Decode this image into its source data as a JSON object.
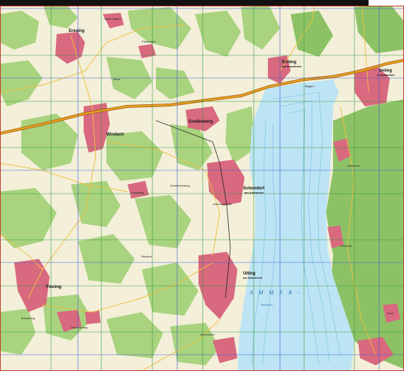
{
  "map": {
    "colors": {
      "background": "#f3efd9",
      "forest": "#a9d37f",
      "forest_dark": "#8cc265",
      "settlement": "#d9697f",
      "settlement_light": "#e9a7b4",
      "water": "#bde4f4",
      "water_contour": "#6fbde4",
      "motorway": "#e8a020",
      "motorway_edge": "#a05a10",
      "road": "#f0c040",
      "grid_green": "#2e9a3a",
      "grid_blue": "#3a5ad8",
      "border": "#c0392b"
    },
    "lake": {
      "name": "A M M E R -",
      "sub": "Ammersee"
    },
    "towns": [
      {
        "id": "eresing",
        "label": "Eresing"
      },
      {
        "id": "eching",
        "label": "Eching",
        "sub": "am Ammersee"
      },
      {
        "id": "inning",
        "label": "Inning",
        "sub": "a. Ammersee"
      },
      {
        "id": "windach",
        "label": "Windach"
      },
      {
        "id": "greifenberg",
        "label": "Greifenberg"
      },
      {
        "id": "schondorf",
        "label": "Schondorf",
        "sub": "am Ammersee"
      },
      {
        "id": "utting",
        "label": "Utting",
        "sub": "am Ammersee"
      },
      {
        "id": "finning",
        "label": "Finning"
      }
    ],
    "villages": [
      {
        "id": "v-sankt-ottilien",
        "label": "Sankt Ottilien"
      },
      {
        "id": "v-pflaumdorf",
        "label": "Pflaumdorf"
      },
      {
        "id": "v-moos",
        "label": "Moos"
      },
      {
        "id": "v-schwifting",
        "label": "Schwifting"
      },
      {
        "id": "v-riederau",
        "label": "Riederau"
      },
      {
        "id": "v-holzhausen",
        "label": "Holzhausen"
      },
      {
        "id": "v-buch",
        "label": "Buch"
      },
      {
        "id": "v-schondorf-sub",
        "label": "Unterschondorf"
      },
      {
        "id": "v-achselschwang",
        "label": "Achselschwang"
      },
      {
        "id": "v-bierdorf",
        "label": "Bierdorf"
      },
      {
        "id": "v-hechenwang",
        "label": "Hechenwang"
      },
      {
        "id": "v-entraching",
        "label": "Entraching"
      },
      {
        "id": "v-stegen",
        "label": "Stegen"
      },
      {
        "id": "v-breitbrunn",
        "label": "Breitbrunn"
      }
    ]
  }
}
